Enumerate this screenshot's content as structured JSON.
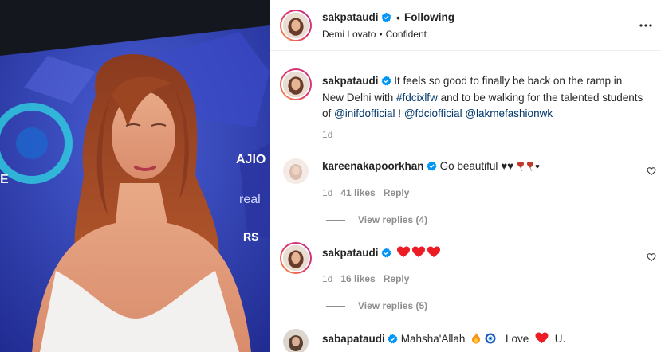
{
  "post": {
    "username": "sakpataudi",
    "separator": "•",
    "follow_status": "Following",
    "music_artist": "Demi Lovato",
    "music_separator": "•",
    "music_title": "Confident",
    "more_icon": "more-horizontal-icon"
  },
  "caption": {
    "username": "sakpataudi",
    "text_1": "It feels so good to finally be back on the ramp in New Delhi with",
    "tag_1": "#fdcixlfw",
    "text_2": "and to be walking for the talented students of",
    "tag_2": "@inifdofficial",
    "text_3": "!",
    "tag_3": "@fdciofficial",
    "tag_4": "@lakmefashionwk",
    "time": "1d"
  },
  "comments": [
    {
      "username": "kareenakapoorkhan",
      "text": "Go beautiful ♥♥",
      "time": "1d",
      "likes": "41 likes",
      "reply": "Reply",
      "view_replies": "View replies (4)"
    },
    {
      "username": "sakpataudi",
      "text": "",
      "time": "1d",
      "likes": "16 likes",
      "reply": "Reply",
      "view_replies": "View replies (5)"
    },
    {
      "username": "sabapataudi",
      "text": "Mahsha'Allah",
      "text_2": "Love",
      "text_3": "U."
    }
  ],
  "colors": {
    "link": "#00376b",
    "verified": "#0095f6",
    "heart": "#ed1c24",
    "muted": "#8e8e8e"
  }
}
